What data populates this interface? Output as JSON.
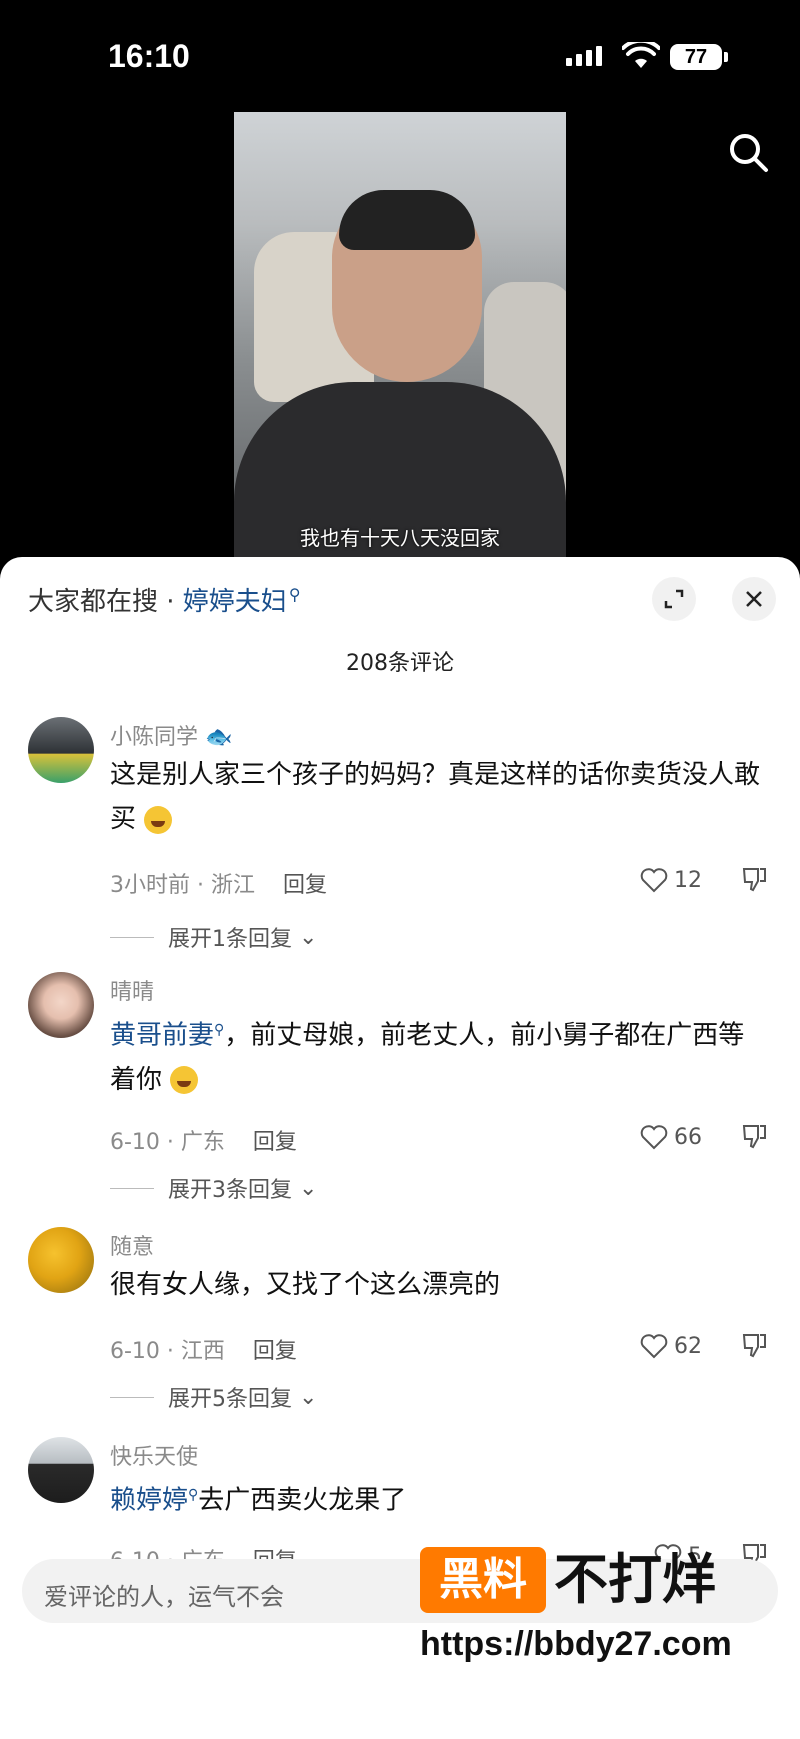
{
  "status_bar": {
    "time": "16:10",
    "battery": "77"
  },
  "video": {
    "subtitle": "我也有十天八天没回家"
  },
  "sheet": {
    "hot_search_prefix": "大家都在搜 · ",
    "hot_search_term": "婷婷夫妇",
    "comment_count": "208条评论"
  },
  "comments": [
    {
      "name": "小陈同学",
      "text": "这是别人家三个孩子的妈妈？真是这样的话你卖货没人敢买",
      "meta": "3小时前 · 浙江",
      "reply": "回复",
      "likes": "12",
      "expand": "展开1条回复"
    },
    {
      "name": "晴晴",
      "link": "黄哥前妻",
      "text": "，前丈母娘，前老丈人，前小舅子都在广西等着你",
      "meta": "6-10 · 广东",
      "reply": "回复",
      "likes": "66",
      "expand": "展开3条回复"
    },
    {
      "name": "随意",
      "text": "很有女人缘，又找了个这么漂亮的",
      "meta": "6-10 · 江西",
      "reply": "回复",
      "likes": "62",
      "expand": "展开5条回复"
    },
    {
      "name": "快乐天使",
      "link": "赖婷婷",
      "text": "去广西卖火龙果了",
      "meta": "6-10 · 广东",
      "reply": "回复",
      "likes": "5"
    }
  ],
  "input": {
    "placeholder": "爱评论的人，运气不会"
  },
  "watermark": {
    "badge": "黑料",
    "title": "不打烊",
    "url": "https://bbdy27.com"
  },
  "colors": {
    "link": "#1a4f8c",
    "accent": "#ff7a00"
  }
}
